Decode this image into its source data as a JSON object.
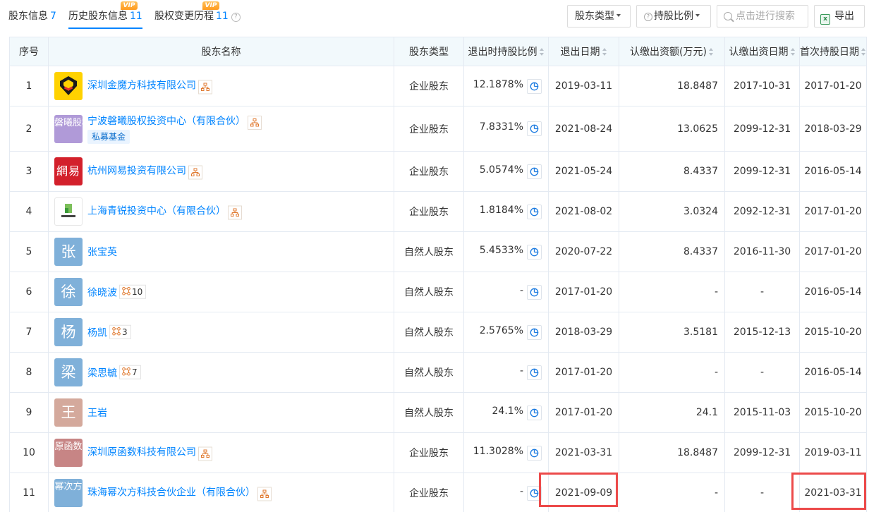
{
  "tabs": [
    {
      "label": "股东信息",
      "count": "7",
      "active": false,
      "vip": false
    },
    {
      "label": "历史股东信息",
      "count": "11",
      "active": true,
      "vip": true
    },
    {
      "label": "股权变更历程",
      "count": "11",
      "active": false,
      "vip": true
    }
  ],
  "vip_label": "VIP",
  "toolbar": {
    "shareholder_type": "股东类型",
    "holding_ratio": "持股比例",
    "search_placeholder": "点击进行搜索",
    "export": "导出"
  },
  "table": {
    "columns": [
      "序号",
      "股东名称",
      "股东类型",
      "退出时持股比例",
      "退出日期",
      "认缴出资额(万元)",
      "认缴出资日期",
      "首次持股日期"
    ],
    "rows": [
      {
        "idx": "1",
        "avatar_text": "",
        "avatar_style": "logo-yellow",
        "name": "深圳金魔方科技有限公司",
        "is_company": true,
        "tag": "",
        "rel_count": "",
        "type": "企业股东",
        "ratio": "12.1878%",
        "exit_date": "2019-03-11",
        "capital": "18.8487",
        "capital_date": "2017-10-31",
        "first_date": "2017-01-20"
      },
      {
        "idx": "2",
        "avatar_text": "磐曦股权",
        "avatar_color": "#b09ad8",
        "name": "宁波磐曦股权投资中心（有限合伙）",
        "is_company": true,
        "tag": "私募基金",
        "rel_count": "",
        "type": "企业股东",
        "ratio": "7.8331%",
        "exit_date": "2021-08-24",
        "capital": "13.0625",
        "capital_date": "2099-12-31",
        "first_date": "2018-03-29"
      },
      {
        "idx": "3",
        "avatar_text": "網易",
        "avatar_style": "logo-netease",
        "name": "杭州网易投资有限公司",
        "is_company": true,
        "tag": "",
        "rel_count": "",
        "type": "企业股东",
        "ratio": "5.0574%",
        "exit_date": "2021-05-24",
        "capital": "8.4337",
        "capital_date": "2099-12-31",
        "first_date": "2016-05-14"
      },
      {
        "idx": "4",
        "avatar_text": "",
        "avatar_style": "logo-white",
        "name": "上海青锐投资中心（有限合伙）",
        "is_company": true,
        "tag": "",
        "rel_count": "",
        "type": "企业股东",
        "ratio": "1.8184%",
        "exit_date": "2021-08-02",
        "capital": "3.0324",
        "capital_date": "2092-12-31",
        "first_date": "2017-01-20"
      },
      {
        "idx": "5",
        "avatar_text": "张",
        "avatar_color": "#7fb0d9",
        "name": "张宝英",
        "is_company": false,
        "tag": "",
        "rel_count": "",
        "type": "自然人股东",
        "ratio": "5.4533%",
        "exit_date": "2020-07-22",
        "capital": "8.4337",
        "capital_date": "2016-11-30",
        "first_date": "2017-01-20"
      },
      {
        "idx": "6",
        "avatar_text": "徐",
        "avatar_color": "#7fb0d9",
        "name": "徐晓波",
        "is_company": false,
        "tag": "",
        "rel_count": "10",
        "type": "自然人股东",
        "ratio": "-",
        "exit_date": "2017-01-20",
        "capital": "-",
        "capital_date": "-",
        "first_date": "2016-05-14"
      },
      {
        "idx": "7",
        "avatar_text": "杨",
        "avatar_color": "#7fb0d9",
        "name": "杨凯",
        "is_company": false,
        "tag": "",
        "rel_count": "3",
        "type": "自然人股东",
        "ratio": "2.5765%",
        "exit_date": "2018-03-29",
        "capital": "3.5181",
        "capital_date": "2015-12-13",
        "first_date": "2015-10-20"
      },
      {
        "idx": "8",
        "avatar_text": "梁",
        "avatar_color": "#7fb0d9",
        "name": "梁思毓",
        "is_company": false,
        "tag": "",
        "rel_count": "7",
        "type": "自然人股东",
        "ratio": "-",
        "exit_date": "2017-01-20",
        "capital": "-",
        "capital_date": "-",
        "first_date": "2016-05-14"
      },
      {
        "idx": "9",
        "avatar_text": "王",
        "avatar_color": "#d4a99c",
        "name": "王岩",
        "is_company": false,
        "tag": "",
        "rel_count": "",
        "type": "自然人股东",
        "ratio": "24.1%",
        "exit_date": "2017-01-20",
        "capital": "24.1",
        "capital_date": "2015-11-03",
        "first_date": "2015-10-20"
      },
      {
        "idx": "10",
        "avatar_text": "原函数",
        "avatar_color": "#c78585",
        "name": "深圳原函数科技有限公司",
        "is_company": true,
        "tag": "",
        "rel_count": "",
        "type": "企业股东",
        "ratio": "11.3028%",
        "exit_date": "2021-03-31",
        "capital": "18.8487",
        "capital_date": "2099-12-31",
        "first_date": "2019-03-11"
      },
      {
        "idx": "11",
        "avatar_text": "幂次方",
        "avatar_color": "#7fb0d9",
        "name": "珠海幂次方科技合伙企业（有限合伙）",
        "is_company": true,
        "tag": "",
        "rel_count": "",
        "type": "企业股东",
        "ratio": "-",
        "exit_date": "2021-09-09",
        "capital": "-",
        "capital_date": "-",
        "first_date": "2021-03-31"
      }
    ]
  },
  "colors": {
    "accent": "#0084ff",
    "header_bg": "#f2f9fc",
    "border": "#e4eaf2",
    "highlight": "#ec4a4a",
    "vip": "#ff9b1f"
  },
  "icons": [
    "tree-icon",
    "relation-icon",
    "pie-chart-icon",
    "search-icon",
    "excel-icon",
    "help-icon"
  ]
}
